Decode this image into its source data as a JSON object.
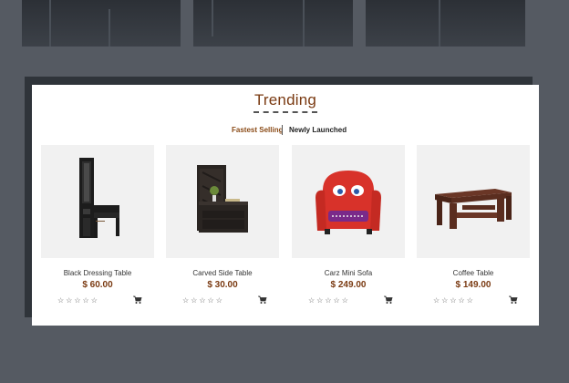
{
  "section": {
    "title": "Trending",
    "tabs": [
      {
        "label": "Fastest Selling",
        "active": true
      },
      {
        "label": "Newly Launched",
        "active": false
      }
    ]
  },
  "products": [
    {
      "name": "Black Dressing Table",
      "price": "$ 60.00",
      "rating": 0,
      "image_icon": "dressing-table-icon"
    },
    {
      "name": "Carved Side Table",
      "price": "$ 30.00",
      "rating": 0,
      "image_icon": "side-table-icon"
    },
    {
      "name": "Carz Mini Sofa",
      "price": "$ 249.00",
      "rating": 0,
      "image_icon": "kids-sofa-icon"
    },
    {
      "name": "Coffee Table",
      "price": "$ 149.00",
      "rating": 0,
      "image_icon": "coffee-table-icon"
    }
  ],
  "colors": {
    "background": "#555a62",
    "accent": "#7a3a12",
    "panel": "#ffffff",
    "image_bg": "#f1f1f1"
  }
}
